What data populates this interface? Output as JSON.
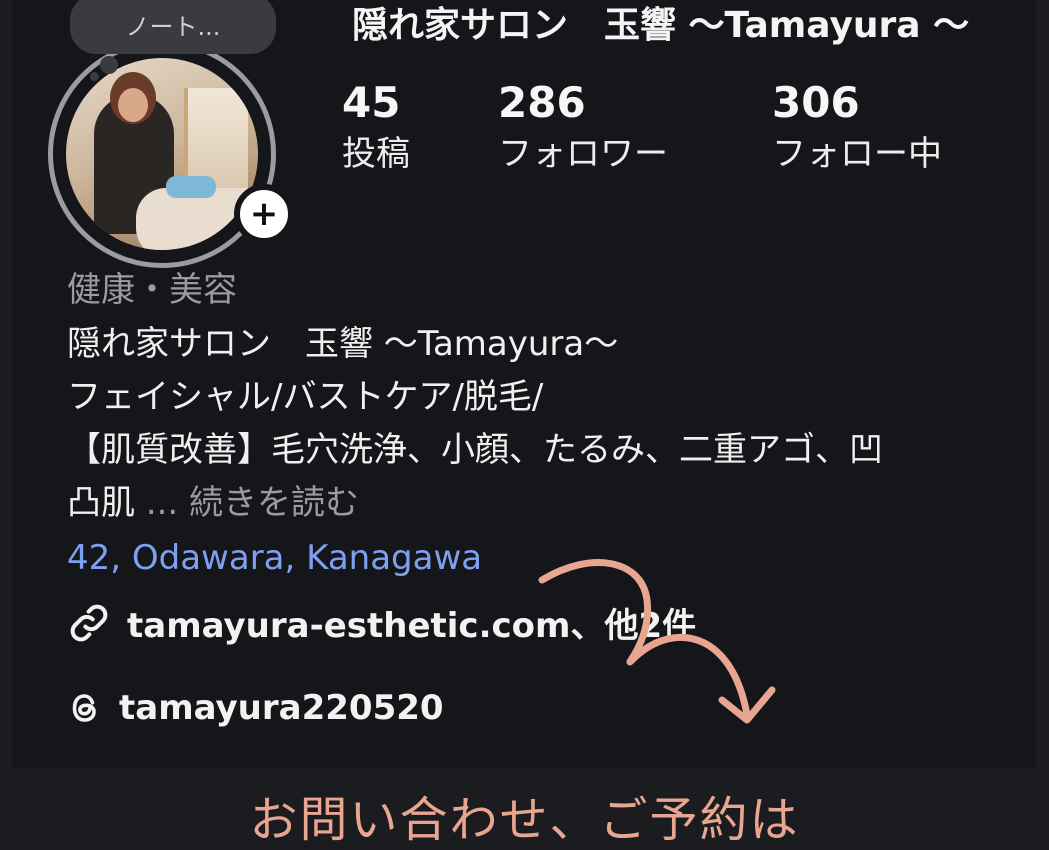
{
  "note": {
    "text": "ノート..."
  },
  "profile": {
    "name": "隠れ家サロン　玉響 〜Tamayura 〜"
  },
  "stats": [
    {
      "value": "45",
      "label": "投稿"
    },
    {
      "value": "286",
      "label": "フォロワー"
    },
    {
      "value": "306",
      "label": "フォロー中"
    }
  ],
  "bio": {
    "category": "健康・美容",
    "lines": [
      "隠れ家サロン　玉響 〜Tamayura〜",
      "フェイシャル/バストケア/脱毛/",
      "【肌質改善】毛穴洗浄、小顔、たるみ、二重アゴ、凹",
      "凸肌"
    ],
    "more_label": "... 続きを読む",
    "location": "42, Odawara, Kanagawa"
  },
  "link": {
    "text": "tamayura-esthetic.com、他2件"
  },
  "threads": {
    "handle": "tamayura220520"
  },
  "caption": {
    "text": "お問い合わせ、ご予約は"
  },
  "colors": {
    "background": "#15161a",
    "location": "#7f9ff0",
    "annotation": "#e8a58f"
  },
  "icons": [
    "plus-icon",
    "link-icon",
    "threads-icon",
    "curved-arrow-icon"
  ]
}
